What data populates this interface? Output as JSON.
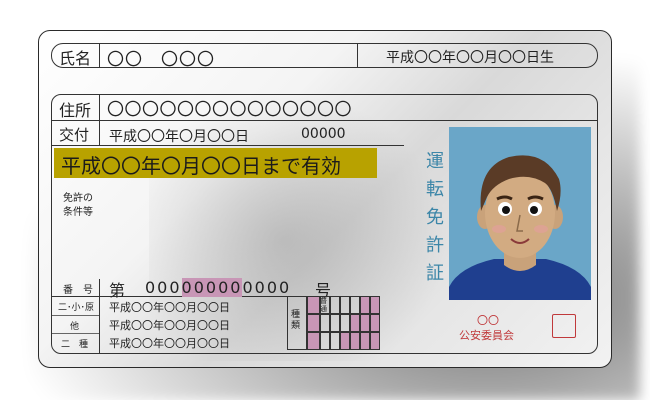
{
  "card": {
    "name_label": "氏名",
    "name_value": "〇〇　〇〇〇",
    "birth_value": "平成〇〇年〇〇月〇〇日生",
    "address_label": "住所",
    "address_value": "〇〇〇〇〇〇〇〇〇〇〇〇〇〇",
    "issue_label": "交付",
    "issue_date": "平成〇〇年〇月〇〇日",
    "issue_number": "00000",
    "expiry_text": "平成〇〇年〇月〇〇日まで有効",
    "conditions_label_1": "免許の",
    "conditions_label_2": "条件等",
    "vertical_title": [
      "運",
      "転",
      "免",
      "許",
      "証"
    ],
    "number_label": "番　号",
    "number_prefix": "第",
    "number_plain_1": "000",
    "number_highlight": "00000",
    "number_plain_2": "0000",
    "number_suffix": "号",
    "row_labels": [
      "二･小･原",
      "他",
      "二　種"
    ],
    "row_dates": [
      "平成〇〇年〇〇月〇〇日",
      "平成〇〇年〇〇月〇〇日",
      "平成〇〇年〇〇月〇〇日"
    ],
    "type_label": "種類",
    "type_first": "普通",
    "issuer_circles": "〇〇",
    "issuer_name": "公安委員会"
  },
  "colors": {
    "highlight": "#b8a200",
    "title_blue": "#3c86a8",
    "stamp_red": "#c0393b",
    "photo_bg": "#6aa6c8",
    "grid_pink": "#c896b6"
  }
}
